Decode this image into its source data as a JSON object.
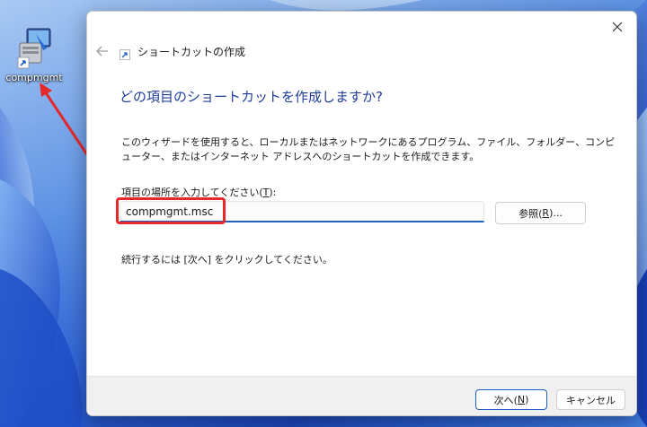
{
  "desktop": {
    "icon_label": "compmgmt"
  },
  "dialog": {
    "window_title": "ショートカットの作成",
    "heading": "どの項目のショートカットを作成しますか?",
    "description": "このウィザードを使用すると、ローカルまたはネットワークにあるプログラム、ファイル、フォルダー、コンピューター、またはインターネット アドレスへのショートカットを作成できます。",
    "field_label_prefix": "項目の場所を入力してください(",
    "field_label_key": "T",
    "field_label_suffix": "):",
    "location_value": "compmgmt.msc",
    "browse_prefix": "参照(",
    "browse_key": "R",
    "browse_suffix": ")...",
    "instruction": "続行するには [次へ] をクリックしてください。",
    "next_prefix": "次へ(",
    "next_key": "N",
    "next_suffix": ")",
    "cancel_label": "キャンセル"
  },
  "colors": {
    "heading": "#1f3d99",
    "highlight": "#e5282a",
    "accent": "#1f5fbf"
  }
}
